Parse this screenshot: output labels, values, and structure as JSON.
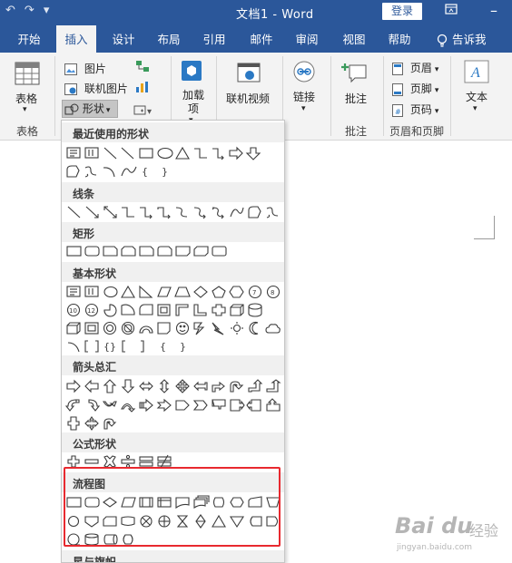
{
  "titlebar": {
    "doc_title": "文档1  -  Word",
    "login": "登录",
    "undo_icon": "undo-icon",
    "redo_icon": "redo-icon",
    "customize_icon": "dropdown-icon"
  },
  "tabs": [
    {
      "label": "开始",
      "active": false
    },
    {
      "label": "插入",
      "active": true
    },
    {
      "label": "设计",
      "active": false
    },
    {
      "label": "布局",
      "active": false
    },
    {
      "label": "引用",
      "active": false
    },
    {
      "label": "邮件",
      "active": false
    },
    {
      "label": "审阅",
      "active": false
    },
    {
      "label": "视图",
      "active": false
    },
    {
      "label": "帮助",
      "active": false
    }
  ],
  "tell_me": "告诉我",
  "ribbon": {
    "table_label": "表格",
    "table_group": "表格",
    "picture": "图片",
    "online_picture": "联机图片",
    "shapes": "形状",
    "addins": "加载\n项",
    "online_video": "联机视频",
    "link": "链接",
    "comment": "批注",
    "comment_group": "批注",
    "header": "页眉",
    "footer": "页脚",
    "page_number": "页码",
    "hf_group": "页眉和页脚",
    "text": "文本"
  },
  "shapes_menu": {
    "categories": [
      {
        "title": "最近使用的形状"
      },
      {
        "title": "线条"
      },
      {
        "title": "矩形"
      },
      {
        "title": "基本形状"
      },
      {
        "title": "箭头总汇"
      },
      {
        "title": "公式形状"
      },
      {
        "title": "流程图"
      },
      {
        "title": "星与旗帜"
      }
    ]
  },
  "watermark": {
    "main": "Bai du",
    "cn": "经验",
    "url": "jingyan.baidu.com"
  },
  "colors": {
    "word_blue": "#2b579a",
    "ribbon_bg": "#f3f3f3",
    "highlight_red": "#e8292f"
  }
}
